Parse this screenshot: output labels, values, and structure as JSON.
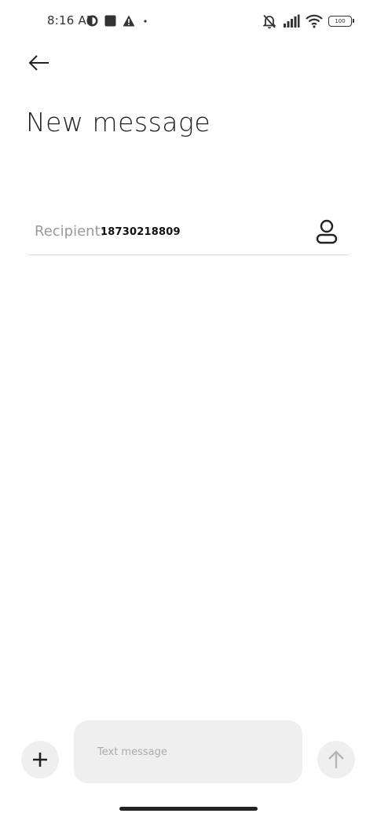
{
  "status_bar": {
    "time": "8:16 AM",
    "left_icons": [
      "app-notification-icon",
      "square-notification-icon",
      "warning-icon",
      "dot-icon"
    ],
    "right_icons": [
      "mute-icon",
      "signal-icon",
      "wifi-icon",
      "battery-icon"
    ],
    "battery_level": "100"
  },
  "header": {
    "back_icon": "back-arrow-icon",
    "title": "New message"
  },
  "recipient": {
    "label": "Recipient:",
    "value": "18730218809",
    "contact_icon": "contact-person-icon"
  },
  "composer": {
    "attach_icon": "plus-icon",
    "placeholder": "Text message",
    "send_icon": "send-arrow-icon"
  }
}
